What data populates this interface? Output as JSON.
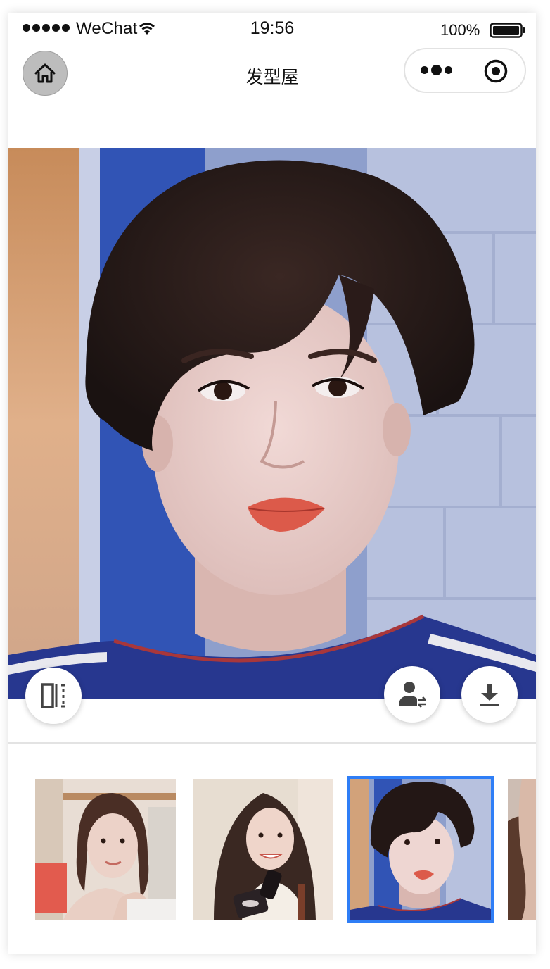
{
  "status_bar": {
    "carrier": "WeChat",
    "time": "19:56",
    "battery_percent": "100%",
    "battery_level": 1.0,
    "signal_bars": 5
  },
  "nav": {
    "title": "发型屋",
    "home_icon": "home-icon",
    "more_icon": "more-dots-icon",
    "close_icon": "target-circle-icon"
  },
  "main_image": {
    "description_icon": "portrait-photo",
    "selected_index": 2
  },
  "actions": {
    "compare_icon": "compare-split-icon",
    "swap_icon": "person-swap-icon",
    "download_icon": "download-icon"
  },
  "thumbnails": {
    "count_visible": 4,
    "selected_index": 2,
    "accent_color": "#2f7ef6"
  }
}
